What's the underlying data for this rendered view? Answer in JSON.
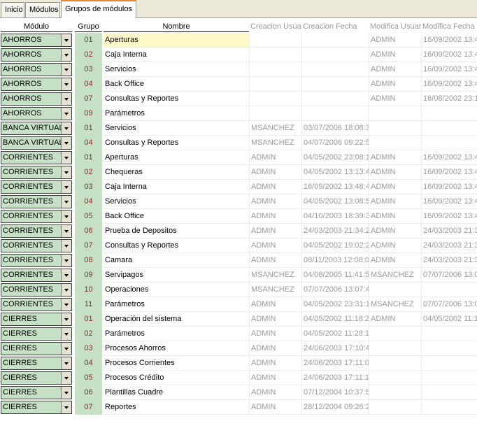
{
  "tabs": [
    {
      "label": "Inicio"
    },
    {
      "label": "Módulos"
    },
    {
      "label": "Grupos de módulos"
    }
  ],
  "columns": {
    "modulo": "Módulo",
    "grupo": "Grupo",
    "nombre": "Nombre",
    "creacion_usuario": "Creacion Usuario",
    "creacion_fecha": "Creacion Fecha",
    "modifica_usuario": "Modifica Usuario",
    "modifica_fecha": "Modifica Fecha"
  },
  "rows": [
    {
      "modulo": "AHORROS",
      "grupo": "01",
      "nombre": "Aperturas",
      "creacion_usuario": "",
      "creacion_fecha": "",
      "modifica_usuario": "ADMIN",
      "modifica_fecha": "16/09/2002 13:4"
    },
    {
      "modulo": "AHORROS",
      "grupo": "02",
      "nombre": "Caja Interna",
      "creacion_usuario": "",
      "creacion_fecha": "",
      "modifica_usuario": "ADMIN",
      "modifica_fecha": "16/09/2002 13:4"
    },
    {
      "modulo": "AHORROS",
      "grupo": "03",
      "nombre": "Servicios",
      "creacion_usuario": "",
      "creacion_fecha": "",
      "modifica_usuario": "ADMIN",
      "modifica_fecha": "16/09/2002 13:4"
    },
    {
      "modulo": "AHORROS",
      "grupo": "04",
      "nombre": "Back Office",
      "creacion_usuario": "",
      "creacion_fecha": "",
      "modifica_usuario": "ADMIN",
      "modifica_fecha": "16/09/2002 13:4"
    },
    {
      "modulo": "AHORROS",
      "grupo": "07",
      "nombre": "Consultas y Reportes",
      "creacion_usuario": "",
      "creacion_fecha": "",
      "modifica_usuario": "ADMIN",
      "modifica_fecha": "16/08/2002 23:1"
    },
    {
      "modulo": "AHORROS",
      "grupo": "09",
      "nombre": "Parámetros",
      "creacion_usuario": "",
      "creacion_fecha": "",
      "modifica_usuario": "",
      "modifica_fecha": ""
    },
    {
      "modulo": "BANCA VIRTUAL",
      "grupo": "01",
      "nombre": "Servicios",
      "creacion_usuario": "MSANCHEZ",
      "creacion_fecha": "03/07/2006 18:06:3",
      "modifica_usuario": "",
      "modifica_fecha": ""
    },
    {
      "modulo": "BANCA VIRTUAL",
      "grupo": "04",
      "nombre": "Consultas y Reportes",
      "creacion_usuario": "MSANCHEZ",
      "creacion_fecha": "04/07/2006 09:22:5",
      "modifica_usuario": "",
      "modifica_fecha": ""
    },
    {
      "modulo": "CORRIENTES",
      "grupo": "01",
      "nombre": "Aperturas",
      "creacion_usuario": "ADMIN",
      "creacion_fecha": "04/05/2002 23:08:1",
      "modifica_usuario": "ADMIN",
      "modifica_fecha": "16/09/2002 13:4"
    },
    {
      "modulo": "CORRIENTES",
      "grupo": "02",
      "nombre": "Chequeras",
      "creacion_usuario": "ADMIN",
      "creacion_fecha": "04/05/2002 13:13:4",
      "modifica_usuario": "ADMIN",
      "modifica_fecha": "16/09/2002 13:4"
    },
    {
      "modulo": "CORRIENTES",
      "grupo": "03",
      "nombre": "Caja Interna",
      "creacion_usuario": "ADMIN",
      "creacion_fecha": "16/09/2002 13:48:4",
      "modifica_usuario": "ADMIN",
      "modifica_fecha": "16/09/2002 13:4"
    },
    {
      "modulo": "CORRIENTES",
      "grupo": "04",
      "nombre": "Servicios",
      "creacion_usuario": "ADMIN",
      "creacion_fecha": "04/05/2002 13:08:5",
      "modifica_usuario": "ADMIN",
      "modifica_fecha": "16/09/2002 13:4"
    },
    {
      "modulo": "CORRIENTES",
      "grupo": "05",
      "nombre": "Back Office",
      "creacion_usuario": "ADMIN",
      "creacion_fecha": "04/10/2003 18:39:3",
      "modifica_usuario": "ADMIN",
      "modifica_fecha": "16/09/2002 13:4"
    },
    {
      "modulo": "CORRIENTES",
      "grupo": "06",
      "nombre": "Prueba de Depositos",
      "creacion_usuario": "ADMIN",
      "creacion_fecha": "24/03/2003 21:34:2",
      "modifica_usuario": "ADMIN",
      "modifica_fecha": "24/03/2003 21:3"
    },
    {
      "modulo": "CORRIENTES",
      "grupo": "07",
      "nombre": "Consultas y Reportes",
      "creacion_usuario": "ADMIN",
      "creacion_fecha": "04/05/2002 19:02:2",
      "modifica_usuario": "ADMIN",
      "modifica_fecha": "24/03/2003 21:3"
    },
    {
      "modulo": "CORRIENTES",
      "grupo": "08",
      "nombre": "Camara",
      "creacion_usuario": "ADMIN",
      "creacion_fecha": "08/11/2003 12:08:0",
      "modifica_usuario": "ADMIN",
      "modifica_fecha": "24/03/2003 21:3"
    },
    {
      "modulo": "CORRIENTES",
      "grupo": "09",
      "nombre": "Servipagos",
      "creacion_usuario": "MSANCHEZ",
      "creacion_fecha": "04/08/2005 11:41:5",
      "modifica_usuario": "MSANCHEZ",
      "modifica_fecha": "07/07/2006 13:0"
    },
    {
      "modulo": "CORRIENTES",
      "grupo": "10",
      "nombre": "Operaciones",
      "creacion_usuario": "MSANCHEZ",
      "creacion_fecha": "07/07/2006 13:07:4",
      "modifica_usuario": "",
      "modifica_fecha": ""
    },
    {
      "modulo": "CORRIENTES",
      "grupo": "11",
      "nombre": "Parámetros",
      "creacion_usuario": "ADMIN",
      "creacion_fecha": "04/05/2002 23:31:1",
      "modifica_usuario": "MSANCHEZ",
      "modifica_fecha": "07/07/2006 13:0"
    },
    {
      "modulo": "CIERRES",
      "grupo": "01",
      "nombre": "Operación del sistema",
      "creacion_usuario": "ADMIN",
      "creacion_fecha": "04/05/2002 11:18:2",
      "modifica_usuario": "ADMIN",
      "modifica_fecha": "04/05/2002 11:1"
    },
    {
      "modulo": "CIERRES",
      "grupo": "02",
      "nombre": "Parámetros",
      "creacion_usuario": "ADMIN",
      "creacion_fecha": "04/05/2002 11:28:1",
      "modifica_usuario": "",
      "modifica_fecha": ""
    },
    {
      "modulo": "CIERRES",
      "grupo": "03",
      "nombre": "Procesos Ahorros",
      "creacion_usuario": "ADMIN",
      "creacion_fecha": "24/06/2003 17:10:4",
      "modifica_usuario": "",
      "modifica_fecha": ""
    },
    {
      "modulo": "CIERRES",
      "grupo": "04",
      "nombre": "Procesos Corrientes",
      "creacion_usuario": "ADMIN",
      "creacion_fecha": "24/06/2003 17:11:0",
      "modifica_usuario": "",
      "modifica_fecha": ""
    },
    {
      "modulo": "CIERRES",
      "grupo": "05",
      "nombre": "Procesos Crédito",
      "creacion_usuario": "ADMIN",
      "creacion_fecha": "24/06/2003 17:11:1",
      "modifica_usuario": "",
      "modifica_fecha": ""
    },
    {
      "modulo": "CIERRES",
      "grupo": "06",
      "nombre": "Plantillas Cuadre",
      "creacion_usuario": "ADMIN",
      "creacion_fecha": "07/12/2004 10:37:5",
      "modifica_usuario": "",
      "modifica_fecha": ""
    },
    {
      "modulo": "CIERRES",
      "grupo": "07",
      "nombre": "Reportes",
      "creacion_usuario": "ADMIN",
      "creacion_fecha": "28/12/2004 09:26:2",
      "modifica_usuario": "",
      "modifica_fecha": ""
    }
  ]
}
